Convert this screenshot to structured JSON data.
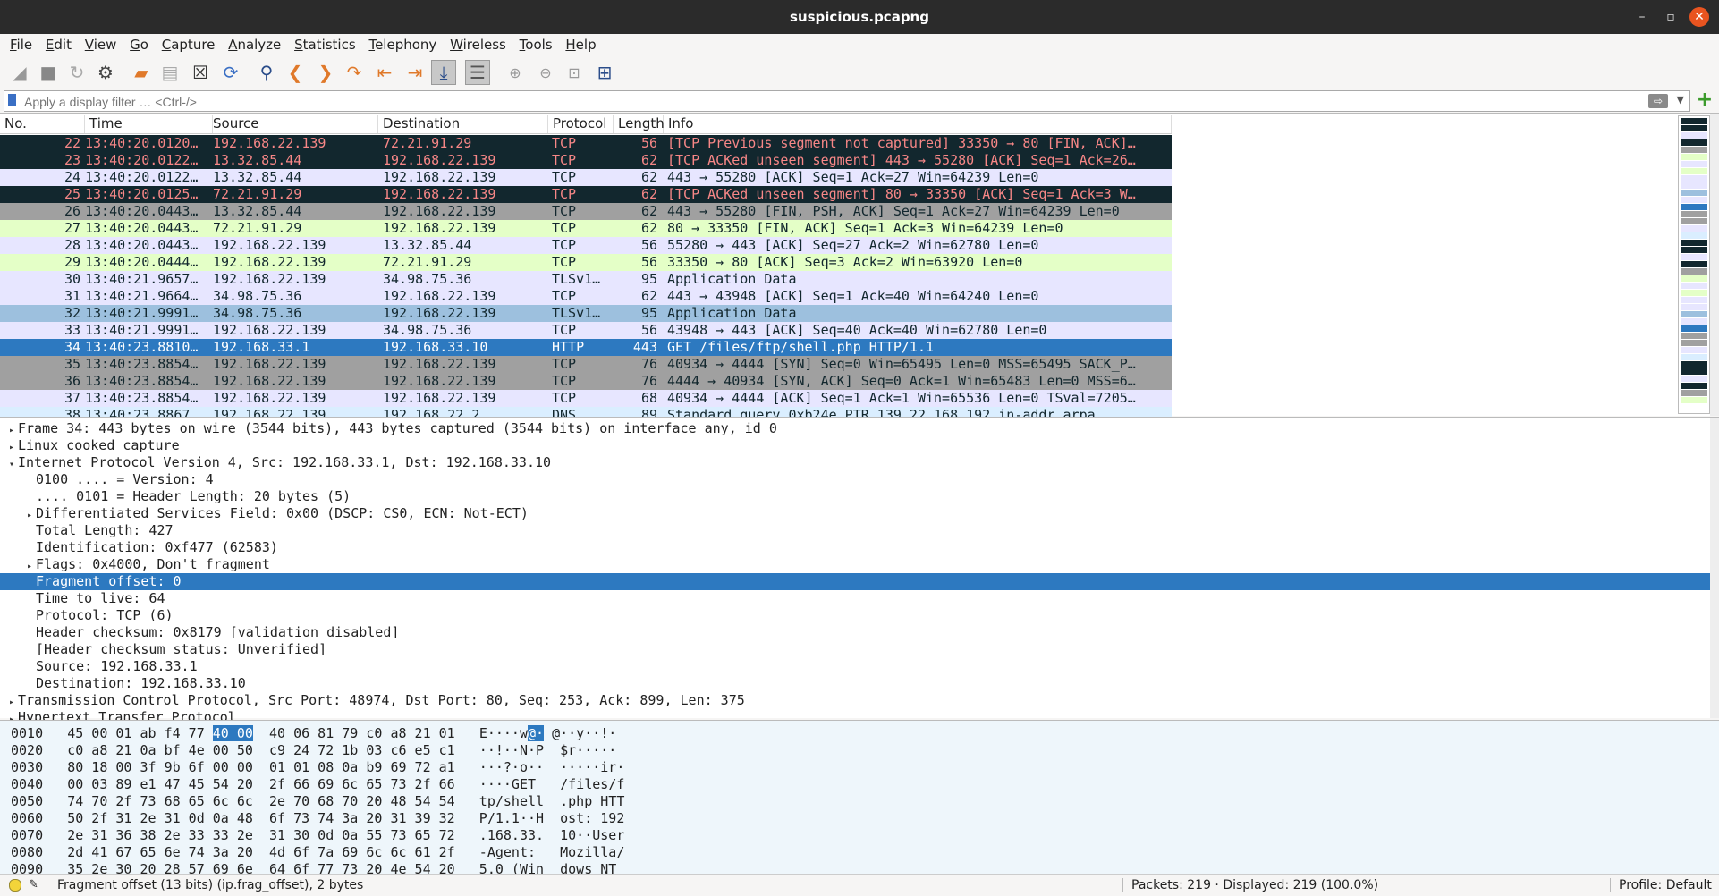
{
  "window": {
    "title": "suspicious.pcapng"
  },
  "menu": [
    "File",
    "Edit",
    "View",
    "Go",
    "Capture",
    "Analyze",
    "Statistics",
    "Telephony",
    "Wireless",
    "Tools",
    "Help"
  ],
  "toolbar_icons": [
    "shark-fin-start-icon",
    "stop-icon",
    "restart-icon",
    "capture-options-icon",
    "open-file-icon",
    "save-icon",
    "close-file-icon",
    "reload-icon",
    "find-icon",
    "back-icon",
    "forward-icon",
    "go-to-packet-icon",
    "first-packet-icon",
    "last-packet-icon",
    "autoscroll-icon",
    "colorize-icon",
    "zoom-in-icon",
    "zoom-out-icon",
    "normal-size-icon",
    "resize-columns-icon"
  ],
  "filter": {
    "placeholder": "Apply a display filter … <Ctrl-/>"
  },
  "packet_list": {
    "columns": [
      "No.",
      "Time",
      "Source",
      "Destination",
      "Protocol",
      "Length",
      "Info"
    ],
    "rows": [
      {
        "no": "22",
        "time": "13:40:20.0120…",
        "src": "192.168.22.139",
        "dst": "72.21.91.29",
        "proto": "TCP",
        "len": "56",
        "info": "[TCP Previous segment not captured] 33350 → 80 [FIN, ACK]…",
        "bg": "#12272e",
        "fg": "#f78787"
      },
      {
        "no": "23",
        "time": "13:40:20.0122…",
        "src": "13.32.85.44",
        "dst": "192.168.22.139",
        "proto": "TCP",
        "len": "62",
        "info": "[TCP ACKed unseen segment] 443 → 55280 [ACK] Seq=1 Ack=26…",
        "bg": "#12272e",
        "fg": "#f78787"
      },
      {
        "no": "24",
        "time": "13:40:20.0122…",
        "src": "13.32.85.44",
        "dst": "192.168.22.139",
        "proto": "TCP",
        "len": "62",
        "info": "443 → 55280 [ACK] Seq=1 Ack=27 Win=64239 Len=0",
        "bg": "#e7e6ff",
        "fg": "#12272e"
      },
      {
        "no": "25",
        "time": "13:40:20.0125…",
        "src": "72.21.91.29",
        "dst": "192.168.22.139",
        "proto": "TCP",
        "len": "62",
        "info": "[TCP ACKed unseen segment] 80 → 33350 [ACK] Seq=1 Ack=3 W…",
        "bg": "#12272e",
        "fg": "#f78787"
      },
      {
        "no": "26",
        "time": "13:40:20.0443…",
        "src": "13.32.85.44",
        "dst": "192.168.22.139",
        "proto": "TCP",
        "len": "62",
        "info": "443 → 55280 [FIN, PSH, ACK] Seq=1 Ack=27 Win=64239 Len=0",
        "bg": "#a0a0a0",
        "fg": "#12272e"
      },
      {
        "no": "27",
        "time": "13:40:20.0443…",
        "src": "72.21.91.29",
        "dst": "192.168.22.139",
        "proto": "TCP",
        "len": "62",
        "info": "80 → 33350 [FIN, ACK] Seq=1 Ack=3 Win=64239 Len=0",
        "bg": "#e4ffc7",
        "fg": "#12272e"
      },
      {
        "no": "28",
        "time": "13:40:20.0443…",
        "src": "192.168.22.139",
        "dst": "13.32.85.44",
        "proto": "TCP",
        "len": "56",
        "info": "55280 → 443 [ACK] Seq=27 Ack=2 Win=62780 Len=0",
        "bg": "#e7e6ff",
        "fg": "#12272e"
      },
      {
        "no": "29",
        "time": "13:40:20.0444…",
        "src": "192.168.22.139",
        "dst": "72.21.91.29",
        "proto": "TCP",
        "len": "56",
        "info": "33350 → 80 [ACK] Seq=3 Ack=2 Win=63920 Len=0",
        "bg": "#e4ffc7",
        "fg": "#12272e"
      },
      {
        "no": "30",
        "time": "13:40:21.9657…",
        "src": "192.168.22.139",
        "dst": "34.98.75.36",
        "proto": "TLSv1…",
        "len": "95",
        "info": "Application Data",
        "bg": "#e7e6ff",
        "fg": "#12272e"
      },
      {
        "no": "31",
        "time": "13:40:21.9664…",
        "src": "34.98.75.36",
        "dst": "192.168.22.139",
        "proto": "TCP",
        "len": "62",
        "info": "443 → 43948 [ACK] Seq=1 Ack=40 Win=64240 Len=0",
        "bg": "#e7e6ff",
        "fg": "#12272e"
      },
      {
        "no": "32",
        "time": "13:40:21.9991…",
        "src": "34.98.75.36",
        "dst": "192.168.22.139",
        "proto": "TLSv1…",
        "len": "95",
        "info": "Application Data",
        "bg": "#9dc0de",
        "fg": "#12272e"
      },
      {
        "no": "33",
        "time": "13:40:21.9991…",
        "src": "192.168.22.139",
        "dst": "34.98.75.36",
        "proto": "TCP",
        "len": "56",
        "info": "43948 → 443 [ACK] Seq=40 Ack=40 Win=62780 Len=0",
        "bg": "#e7e6ff",
        "fg": "#12272e"
      },
      {
        "no": "34",
        "time": "13:40:23.8810…",
        "src": "192.168.33.1",
        "dst": "192.168.33.10",
        "proto": "HTTP",
        "len": "443",
        "info": "GET /files/ftp/shell.php HTTP/1.1",
        "bg": "#2d79c0",
        "fg": "#ffffff"
      },
      {
        "no": "35",
        "time": "13:40:23.8854…",
        "src": "192.168.22.139",
        "dst": "192.168.22.139",
        "proto": "TCP",
        "len": "76",
        "info": "40934 → 4444 [SYN] Seq=0 Win=65495 Len=0 MSS=65495 SACK_P…",
        "bg": "#a0a0a0",
        "fg": "#12272e"
      },
      {
        "no": "36",
        "time": "13:40:23.8854…",
        "src": "192.168.22.139",
        "dst": "192.168.22.139",
        "proto": "TCP",
        "len": "76",
        "info": "4444 → 40934 [SYN, ACK] Seq=0 Ack=1 Win=65483 Len=0 MSS=6…",
        "bg": "#a0a0a0",
        "fg": "#12272e"
      },
      {
        "no": "37",
        "time": "13:40:23.8854…",
        "src": "192.168.22.139",
        "dst": "192.168.22.139",
        "proto": "TCP",
        "len": "68",
        "info": "40934 → 4444 [ACK] Seq=1 Ack=1 Win=65536 Len=0 TSval=7205…",
        "bg": "#e7e6ff",
        "fg": "#12272e"
      },
      {
        "no": "38",
        "time": "13:40:23.8867…",
        "src": "192.168.22.139",
        "dst": "192.168.22.2",
        "proto": "DNS",
        "len": "89",
        "info": "Standard query 0xb24e PTR 139.22.168.192.in-addr.arpa",
        "bg": "#daeeff",
        "fg": "#12272e"
      }
    ]
  },
  "details": [
    {
      "indent": 0,
      "tw": "▸",
      "text": "Frame 34: 443 bytes on wire (3544 bits), 443 bytes captured (3544 bits) on interface any, id 0"
    },
    {
      "indent": 0,
      "tw": "▸",
      "text": "Linux cooked capture"
    },
    {
      "indent": 0,
      "tw": "▾",
      "text": "Internet Protocol Version 4, Src: 192.168.33.1, Dst: 192.168.33.10"
    },
    {
      "indent": 1,
      "tw": "",
      "text": "0100 .... = Version: 4"
    },
    {
      "indent": 1,
      "tw": "",
      "text": ".... 0101 = Header Length: 20 bytes (5)"
    },
    {
      "indent": 1,
      "tw": "▸",
      "text": "Differentiated Services Field: 0x00 (DSCP: CS0, ECN: Not-ECT)"
    },
    {
      "indent": 1,
      "tw": "",
      "text": "Total Length: 427"
    },
    {
      "indent": 1,
      "tw": "",
      "text": "Identification: 0xf477 (62583)"
    },
    {
      "indent": 1,
      "tw": "▸",
      "text": "Flags: 0x4000, Don't fragment"
    },
    {
      "indent": 1,
      "tw": "",
      "text": "Fragment offset: 0",
      "selected": true
    },
    {
      "indent": 1,
      "tw": "",
      "text": "Time to live: 64"
    },
    {
      "indent": 1,
      "tw": "",
      "text": "Protocol: TCP (6)"
    },
    {
      "indent": 1,
      "tw": "",
      "text": "Header checksum: 0x8179 [validation disabled]"
    },
    {
      "indent": 1,
      "tw": "",
      "text": "[Header checksum status: Unverified]"
    },
    {
      "indent": 1,
      "tw": "",
      "text": "Source: 192.168.33.1"
    },
    {
      "indent": 1,
      "tw": "",
      "text": "Destination: 192.168.33.10"
    },
    {
      "indent": 0,
      "tw": "▸",
      "text": "Transmission Control Protocol, Src Port: 48974, Dst Port: 80, Seq: 253, Ack: 899, Len: 375"
    },
    {
      "indent": 0,
      "tw": "▸",
      "text": "Hypertext Transfer Protocol"
    }
  ],
  "bytes": [
    {
      "off": "0010",
      "hex1": "45 00 01 ab f4 77 ",
      "hl": "40 00",
      "hex2": "  40 06 81 79 c0 a8 21 01",
      "ascii1": "E····w",
      "ahl": "@·",
      "ascii2": " @··y··!·"
    },
    {
      "off": "0020",
      "hex1": "c0 a8 21 0a bf 4e 00 50  c9 24 72 1b 03 c6 e5 c1",
      "hl": "",
      "hex2": "",
      "ascii1": "··!··N·P  $r·····",
      "ahl": "",
      "ascii2": ""
    },
    {
      "off": "0030",
      "hex1": "80 18 00 3f 9b 6f 00 00  01 01 08 0a b9 69 72 a1",
      "hl": "",
      "hex2": "",
      "ascii1": "···?·o··  ·····ir·",
      "ahl": "",
      "ascii2": ""
    },
    {
      "off": "0040",
      "hex1": "00 03 89 e1 47 45 54 20  2f 66 69 6c 65 73 2f 66",
      "hl": "",
      "hex2": "",
      "ascii1": "····GET   /files/f",
      "ahl": "",
      "ascii2": ""
    },
    {
      "off": "0050",
      "hex1": "74 70 2f 73 68 65 6c 6c  2e 70 68 70 20 48 54 54",
      "hl": "",
      "hex2": "",
      "ascii1": "tp/shell  .php HTT",
      "ahl": "",
      "ascii2": ""
    },
    {
      "off": "0060",
      "hex1": "50 2f 31 2e 31 0d 0a 48  6f 73 74 3a 20 31 39 32",
      "hl": "",
      "hex2": "",
      "ascii1": "P/1.1··H  ost: 192",
      "ahl": "",
      "ascii2": ""
    },
    {
      "off": "0070",
      "hex1": "2e 31 36 38 2e 33 33 2e  31 30 0d 0a 55 73 65 72",
      "hl": "",
      "hex2": "",
      "ascii1": ".168.33.  10··User",
      "ahl": "",
      "ascii2": ""
    },
    {
      "off": "0080",
      "hex1": "2d 41 67 65 6e 74 3a 20  4d 6f 7a 69 6c 6c 61 2f",
      "hl": "",
      "hex2": "",
      "ascii1": "-Agent:   Mozilla/",
      "ahl": "",
      "ascii2": ""
    },
    {
      "off": "0090",
      "hex1": "35 2e 30 20 28 57 69 6e  64 6f 77 73 20 4e 54 20",
      "hl": "",
      "hex2": "",
      "ascii1": "5.0 (Win  dows NT ",
      "ahl": "",
      "ascii2": ""
    }
  ],
  "status": {
    "field": "Fragment offset (13 bits) (ip.frag_offset), 2 bytes",
    "counts": "Packets: 219 · Displayed: 219 (100.0%)",
    "profile": "Profile: Default"
  }
}
